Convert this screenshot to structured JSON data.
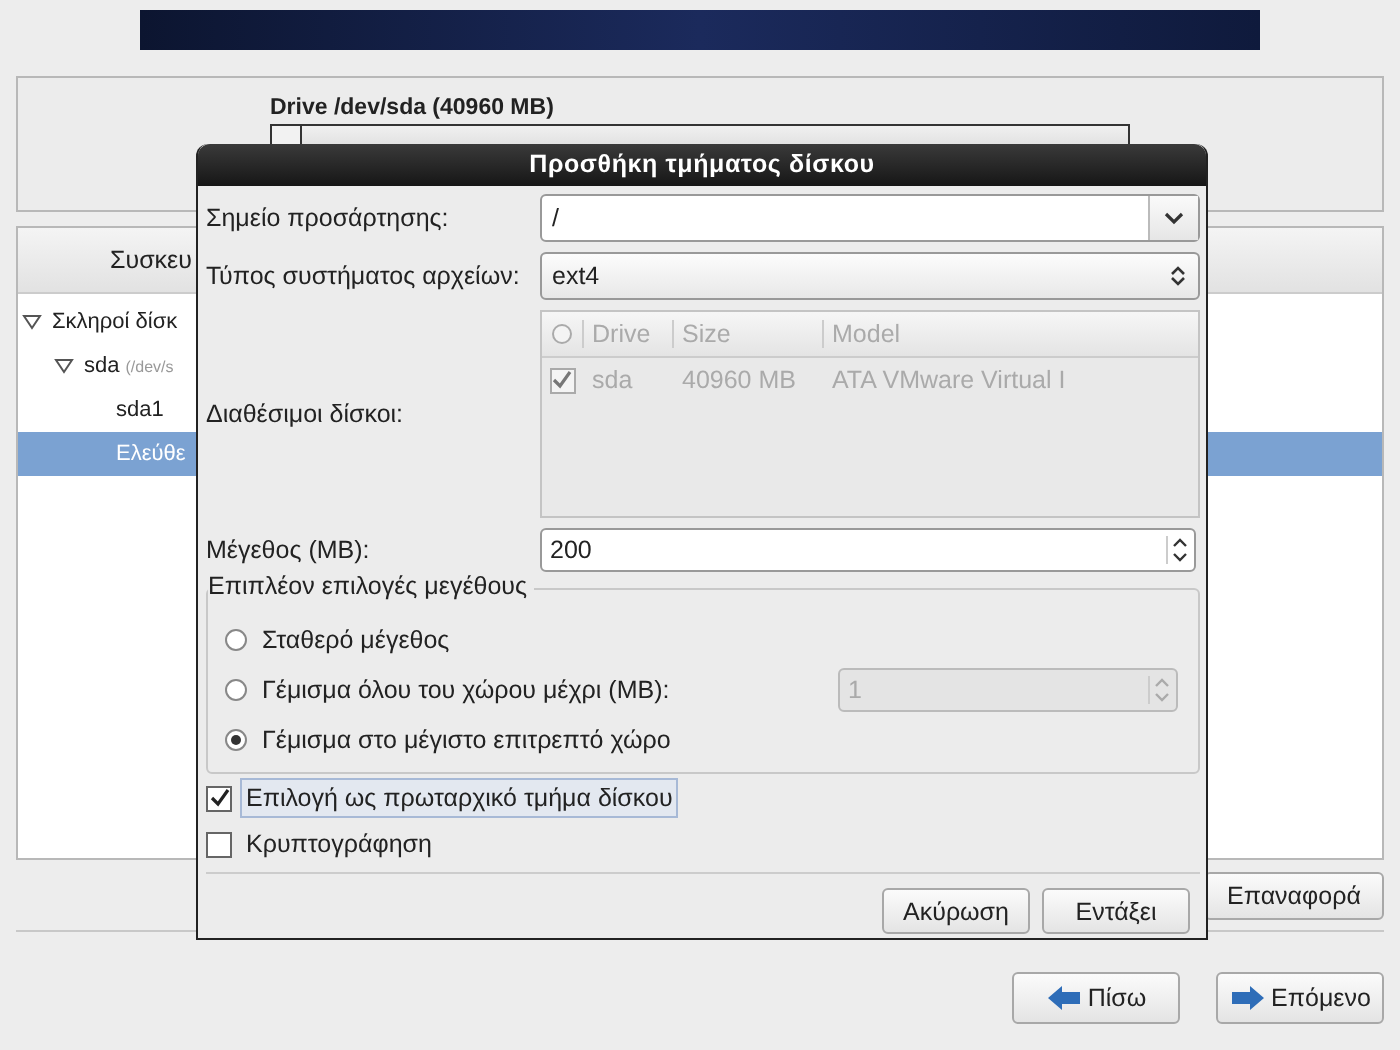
{
  "drive_panel": {
    "title": "Drive /dev/sda (40960 MB)"
  },
  "device_list": {
    "header": "Συσκευ",
    "items": [
      {
        "label": "Σκληροί δίσκ",
        "expanded": true,
        "selected": false,
        "children": [
          {
            "label": "sda",
            "detail": "(/dev/s",
            "expanded": true,
            "selected": false,
            "children": [
              {
                "label": "sda1",
                "selected": false
              },
              {
                "label": "Ελεύθε",
                "selected": true
              }
            ]
          }
        ]
      }
    ]
  },
  "reset_button": "Επαναφορά",
  "nav_buttons": [
    {
      "label": "Πίσω",
      "kind": "back"
    },
    {
      "label": "Επόμενο",
      "kind": "next"
    }
  ],
  "dialog": {
    "title": "Προσθήκη τμήματος δίσκου",
    "mount_point": {
      "label": "Σημείο προσάρτησης:",
      "value": "/"
    },
    "filesystem": {
      "label": "Τύπος συστήματος αρχείων:",
      "value": "ext4"
    },
    "disks": {
      "label": "Διαθέσιμοι δίσκοι:",
      "disabled": true,
      "columns": [
        "Drive",
        "Size",
        "Model"
      ],
      "rows": [
        {
          "checked": true,
          "drive": "sda",
          "size": "40960 MB",
          "model": "ATA VMware Virtual I"
        }
      ]
    },
    "size": {
      "label": "Μέγεθος (MB):",
      "value": "200"
    },
    "size_options": {
      "legend": "Επιπλέον επιλογές μεγέθους",
      "options": [
        {
          "label": "Σταθερό μέγεθος",
          "selected": false
        },
        {
          "label": "Γέμισμα όλου του χώρου μέχρι (MB):",
          "selected": false,
          "value": "1",
          "disabled": true
        },
        {
          "label": "Γέμισμα στο μέγιστο επιτρεπτό χώρο",
          "selected": true
        }
      ]
    },
    "checkboxes": [
      {
        "label": "Επιλογή ως πρωταρχικό τμήμα δίσκου",
        "checked": true,
        "focused": true
      },
      {
        "label": "Κρυπτογράφηση",
        "checked": false,
        "focused": false
      }
    ],
    "buttons": [
      "Ακύρωση",
      "Εντάξει"
    ]
  }
}
